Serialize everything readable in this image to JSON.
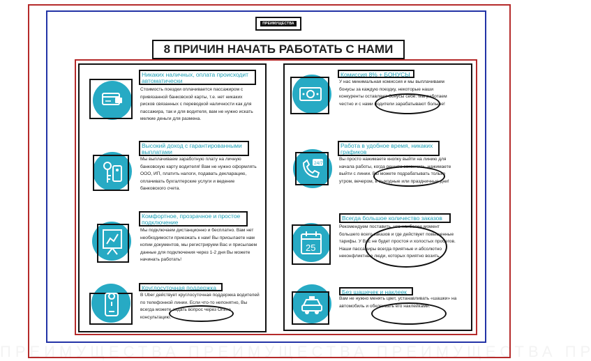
{
  "page": {
    "badge": "ПРЕИМУЩЕСТВА",
    "headline": "8 ПРИЧИН НАЧАТЬ РАБОТАТЬ С НАМИ"
  },
  "features": [
    {
      "title": "Никаких наличных, оплата происходит автоматически",
      "text": "Стоимость поездки оплачивается пассажиром с привязанной банковской карты, т.е. нет никаких рисков связанных с переводкой наличности как для пассажира, так и для водителя, вам не нужно искать мелкие деньги для размена.",
      "icon": "card-wallet-icon"
    },
    {
      "title": "Высокий доход с гарантированными выплатами",
      "text": "Мы выплачиваем заработную плату на личную банковскую карту водителя! Вам не нужно оформлять ООО, ИП, платить налоги, подавать декларацию, оплачивать бухгалтерские услуги и ведение банковского счета.",
      "icon": "keys-icon"
    },
    {
      "title": "Комфортное, прозрачное и простое подключение",
      "text": "Мы подключаем дистанционно и бесплатно. Вам нет необходимости приезжать к нам! Вы присылаете нам копии документов, мы регистрируем Вас и присылаем данные для подключения через 1-2 дня Вы можете начинать работать!",
      "icon": "presentation-icon"
    },
    {
      "title": "Круглосуточная поддержка",
      "text": "В Uber действует круглосуточная поддержка водителей по телефонной линии. Если что-то непонятно, Вы всегда можете задать вопрос через Online консультацию.",
      "icon": "phone-map-icon"
    },
    {
      "title": "Комиссия 8% + БОНУСЫ",
      "text": "У нас минимальная комиссия и мы выплачиваем бонусы за каждую поездку, некоторые наши конкуренты оставляют бонусы себе. Мы работаем честно и с нами водители зарабатывают больше!",
      "icon": "money-icon"
    },
    {
      "title": "Работа в удобное время, никаких графиков",
      "text": "Вы просто нажимаете кнопку выйти на линию для начала работы, когда решите закончить, нажимаете выйти с линии. Вы можете подрабатывать только утром, вечером, в выходные или праздничные дни!",
      "icon": "phone-24-7-icon"
    },
    {
      "title": "Всегда большое количество заказов",
      "text": "Рекомендуем поставить, что наиболее момент большего всего заказов и где действует повышенные тарифы. У Вас не будет простоя и холостых пробегов. Наши пассажиры всегда приятные и абсолютно неконфликтные люди, которых приятно возить.",
      "icon": "calendar-icon",
      "calendar_day": "25"
    },
    {
      "title": "Без шашечек и наклеек",
      "text": "Вам не нужно менять цвет, устанавливать «шашки» на автомобиль и обклеивать его наклейками.",
      "icon": "taxi-car-icon"
    }
  ],
  "colors": {
    "accent": "#27aac4",
    "title": "#1d9fb5",
    "frame_red": "#b52a2a",
    "frame_blue": "#2233a6"
  },
  "watermark": "ПРЕИМУЩЕСТВА ПРЕИМУЩЕСТВА ПРЕИМУЩЕСТВА ПРЕИМУЩЕСТВА ПРЕИМУЩЕСТВА"
}
